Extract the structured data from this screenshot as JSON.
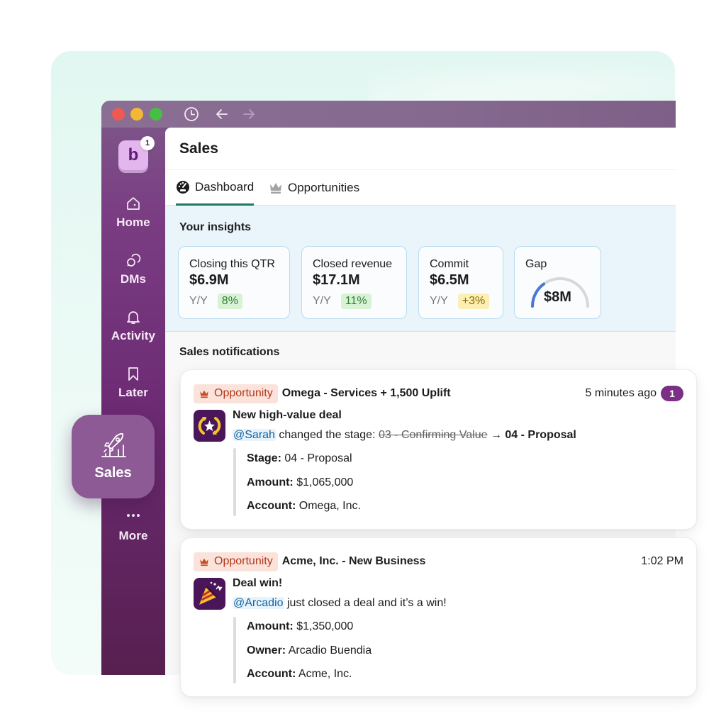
{
  "window": {
    "traffic_lights": [
      "close",
      "minimize",
      "maximize"
    ],
    "toolbar_icons": [
      "history-icon",
      "back-arrow-icon",
      "forward-arrow-icon"
    ]
  },
  "workspace": {
    "initial": "b",
    "badge": "1"
  },
  "sidebar": {
    "items": [
      {
        "label": "Home",
        "icon": "home-icon"
      },
      {
        "label": "DMs",
        "icon": "dms-icon"
      },
      {
        "label": "Activity",
        "icon": "bell-icon"
      },
      {
        "label": "Later",
        "icon": "bookmark-icon"
      },
      {
        "label": "Sales",
        "icon": "rocket-chart-icon",
        "active": true
      },
      {
        "label": "More",
        "icon": "ellipsis-icon"
      }
    ]
  },
  "main": {
    "title": "Sales",
    "tabs": [
      {
        "label": "Dashboard",
        "icon": "dashboard-gauge-icon",
        "active": true
      },
      {
        "label": "Opportunities",
        "icon": "crown-icon",
        "active": false
      }
    ],
    "insights": {
      "title": "Your insights",
      "cards": [
        {
          "label": "Closing this QTR",
          "value": "$6.9M",
          "yoy_label": "Y/Y",
          "change": "8%",
          "change_tone": "positive"
        },
        {
          "label": "Closed revenue",
          "value": "$17.1M",
          "yoy_label": "Y/Y",
          "change": "11%",
          "change_tone": "positive"
        },
        {
          "label": "Commit",
          "value": "$6.5M",
          "yoy_label": "Y/Y",
          "change": "+3%",
          "change_tone": "neutral"
        },
        {
          "label": "Gap",
          "value": "$8M",
          "gauge_fraction": 0.3
        }
      ]
    },
    "notifications_title": "Sales notifications"
  },
  "notifications": [
    {
      "tag": "Opportunity",
      "subject": "Omega - Services + 1,500 Uplift",
      "time": "5 minutes ago",
      "unread": "1",
      "app_icon": "refresh-star-icon",
      "title": "New high-value deal",
      "mention": "@Sarah",
      "text": " changed the stage: ",
      "old_stage": "03 - Confirming Value",
      "arrow": " → ",
      "new_stage": "04 - Proposal",
      "fields": [
        {
          "label": "Stage:",
          "value": " 04 - Proposal"
        },
        {
          "label": "Amount:",
          "value": " $1,065,000"
        },
        {
          "label": "Account:",
          "value": " Omega, Inc."
        }
      ]
    },
    {
      "tag": "Opportunity",
      "subject": "Acme, Inc. - New Business",
      "time": "1:02 PM",
      "app_icon": "party-popper-icon",
      "title": "Deal win!",
      "mention": "@Arcadio",
      "text": " just closed a deal and it’s a win!",
      "fields": [
        {
          "label": "Amount:",
          "value": " $1,350,000"
        },
        {
          "label": "Owner:",
          "value": " Arcadio Buendia"
        },
        {
          "label": "Account:",
          "value": " Acme, Inc."
        }
      ]
    }
  ],
  "colors": {
    "sidebar_purple": "#6c2a73",
    "active_tab_underline": "#1f7a5c",
    "opportunity_chip_bg": "#fbe3dc",
    "opportunity_chip_text": "#b2391c",
    "mention": "#1264a3",
    "unread_badge": "#7c3085",
    "gauge_fill": "#4a78d6"
  }
}
